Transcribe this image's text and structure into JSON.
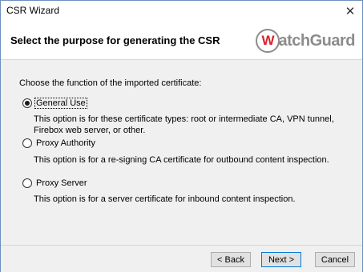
{
  "window": {
    "title": "CSR Wizard",
    "close_glyph": "✕"
  },
  "header": {
    "title": "Select the purpose for generating the CSR",
    "logo_w": "W",
    "logo_text": "atchGuard"
  },
  "main": {
    "prompt": "Choose the function of the imported certificate:",
    "options": [
      {
        "label": "General Use",
        "selected": true,
        "description": "This option is for these certificate types: root or intermediate CA, VPN tunnel, Firebox web server, or other."
      },
      {
        "label": "Proxy Authority",
        "selected": false,
        "description": "This option is for a re-signing CA certificate for outbound content inspection."
      },
      {
        "label": "Proxy Server",
        "selected": false,
        "description": "This option is for a server certificate for inbound content inspection."
      }
    ]
  },
  "footer": {
    "back_label": "< Back",
    "next_label": "Next >",
    "cancel_label": "Cancel"
  },
  "colors": {
    "logo_red": "#d9232e",
    "logo_gray": "#8c8c8c",
    "primary_button_border": "#0078d7"
  }
}
